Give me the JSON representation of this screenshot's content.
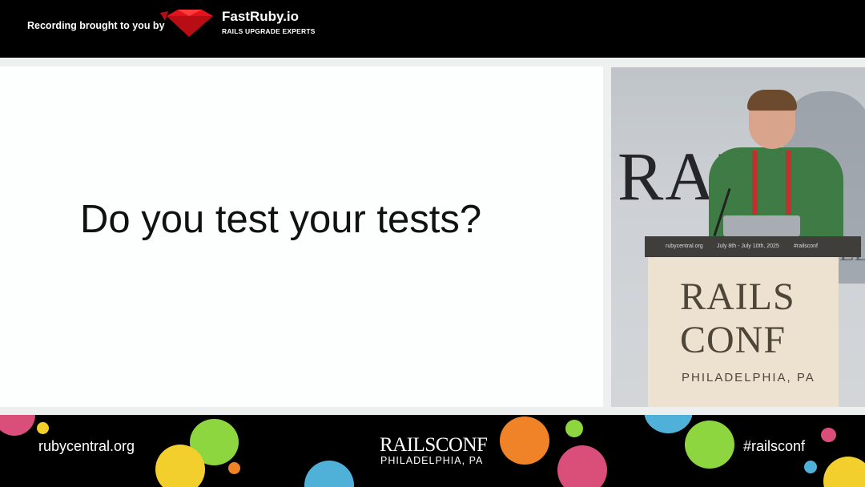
{
  "header": {
    "recording_label": "Recording brought to you by",
    "brand_name": "FastRuby.io",
    "brand_tagline": "RAILS UPGRADE EXPERTS"
  },
  "slide": {
    "text": "Do you test your tests?"
  },
  "speaker_video": {
    "wall_text": "RAILS",
    "wall_text_partial": "EL",
    "podium_strip": {
      "left": "rubycentral.org",
      "center": "July 8th - July 10th, 2025",
      "right": "#railsconf"
    },
    "podium_line1": "RAILS",
    "podium_line2": "CONF",
    "podium_city": "PHILADELPHIA, PA"
  },
  "footer": {
    "left_link": "rubycentral.org",
    "logo": "RAILSCONF",
    "city": "PHILADELPHIA, PA",
    "hashtag": "#railsconf"
  },
  "colors": {
    "brand_red": "#e3121b",
    "dot_pink": "#d94f7a",
    "dot_green": "#8dd63f",
    "dot_yellow": "#f3cf2e",
    "dot_orange": "#f08227",
    "dot_blue": "#4fb0d8"
  }
}
